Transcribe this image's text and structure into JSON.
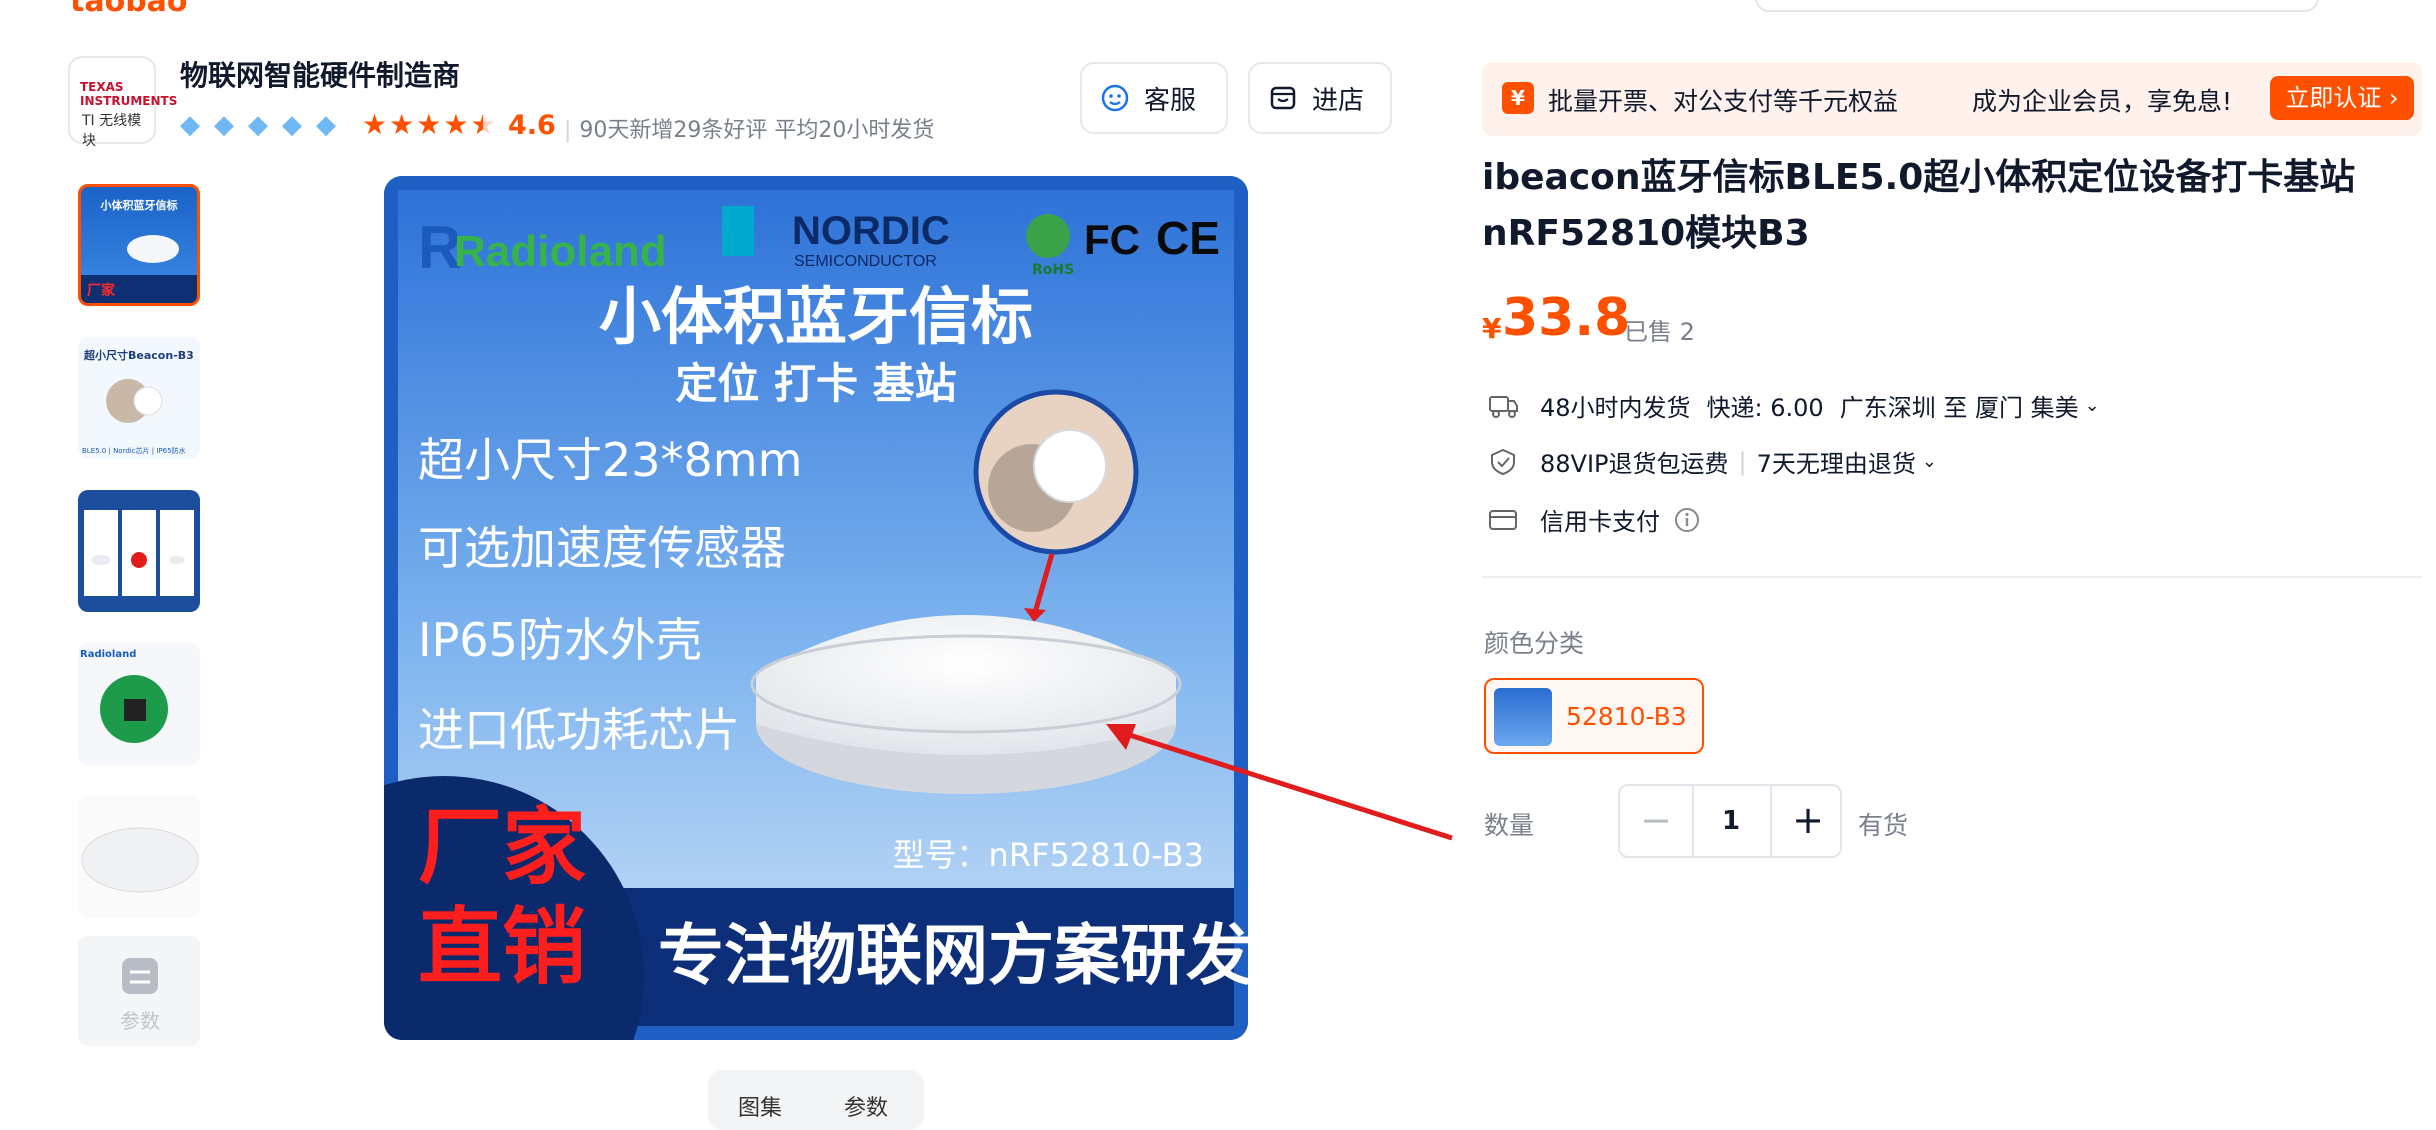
{
  "header_fragment": {
    "logo": "taobao"
  },
  "shop": {
    "logo_text": "TEXAS INSTRUMENTS",
    "logo_subtext": "TI 无线模块",
    "name": "物联网智能硬件制造商",
    "rating": "4.6",
    "stats": "90天新增29条好评   平均20小时发货",
    "diamond_count": 5,
    "stars": 4.5
  },
  "actions": {
    "service": "客服",
    "store": "进店"
  },
  "gallery": {
    "thumbnails": [
      "main",
      "beacon-b3",
      "comparison",
      "pcb",
      "device",
      "params"
    ],
    "thumb_texts": {
      "t1": "小体积蓝牙信标",
      "t2": "超小尺寸Beacon-B3",
      "t2b": "BLE5.0 | Nordic芯片 | IP65防水",
      "t6": "参数"
    }
  },
  "main_image": {
    "brand": "Radioland",
    "chip_brand": "NORDIC",
    "chip_sub": "SEMICONDUCTOR",
    "rohs": "RoHS",
    "cert1": "FC",
    "cert2": "CE",
    "headline": "小体积蓝牙信标",
    "subheadline": "定位 打卡 基站",
    "features": [
      "超小尺寸23*8mm",
      "可选加速度传感器",
      "IP65防水外壳",
      "进口低功耗芯片"
    ],
    "model": "型号：nRF52810-B3",
    "badge_line1": "厂家",
    "badge_line2": "直销",
    "bottom_slogan": "专注物联网方案研发"
  },
  "tabs": [
    "图集",
    "参数"
  ],
  "promo": {
    "icon": "¥",
    "text": "批量开票、对公支付等千元权益",
    "text2": "成为企业会员，享免息!",
    "button": "立即认证 ›"
  },
  "product": {
    "title": "ibeacon蓝牙信标BLE5.0超小体积定位设备打卡基站nRF52810模块B3",
    "currency": "¥",
    "price": "33.8",
    "sold": "已售 2"
  },
  "shipping": {
    "dispatch": "48小时内发货",
    "express": "快递: 6.00",
    "route": "广东深圳 至 厦门 集美",
    "vip": "88VIP退货包运费",
    "returns": "7天无理由退货",
    "payment": "信用卡支付"
  },
  "options": {
    "color_label": "颜色分类",
    "color_value": "52810-B3",
    "qty_label": "数量",
    "qty": "1",
    "stock": "有货"
  },
  "colors": {
    "accent": "#ff5000",
    "banner_bg": "#fff1eb",
    "text": "#11192d",
    "muted": "#7a7f8c"
  }
}
